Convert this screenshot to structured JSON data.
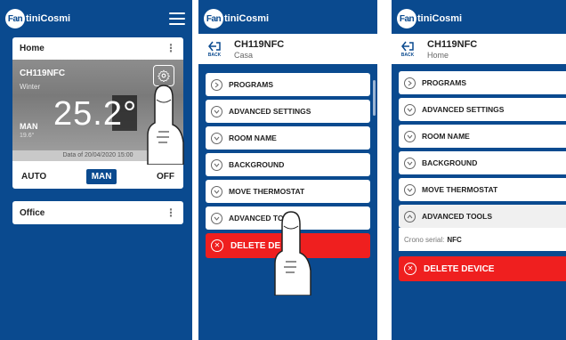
{
  "brand": "FantiniCosmi",
  "brand_badge": "Fan",
  "brand_text": "tiniCosmi",
  "colors": {
    "primary": "#0a4a8f",
    "danger": "#ef1f1f",
    "card": "#ffffff"
  },
  "screen1": {
    "menu_icon": "hamburger-icon",
    "group_home": "Home",
    "thermostat": {
      "name": "CH119NFC",
      "season": "Winter",
      "mode": "MAN",
      "setpoint": "19.6°",
      "temperature": "25.2°",
      "settings_icon": "gear-icon",
      "date": "Data of 20/04/2020 15:00"
    },
    "modes": [
      "AUTO",
      "MAN",
      "OFF"
    ],
    "active_mode": "MAN",
    "group_office": "Office"
  },
  "screen2": {
    "back_label": "BACK",
    "device_name": "CH119NFC",
    "device_sub": "Casa",
    "menu": [
      "PROGRAMS",
      "ADVANCED SETTINGS",
      "ROOM NAME",
      "BACKGROUND",
      "MOVE THERMOSTAT",
      "ADVANCED TOOLS"
    ],
    "delete_label": "DELETE DE"
  },
  "screen3": {
    "back_label": "BACK",
    "device_name": "CH119NFC",
    "device_sub": "Home",
    "menu": [
      "PROGRAMS",
      "ADVANCED SETTINGS",
      "ROOM NAME",
      "BACKGROUND",
      "MOVE THERMOSTAT"
    ],
    "expanded_item": "ADVANCED TOOLS",
    "serial_label": "Crono serial:",
    "serial_value": "NFC",
    "delete_label": "DELETE DEVICE"
  }
}
